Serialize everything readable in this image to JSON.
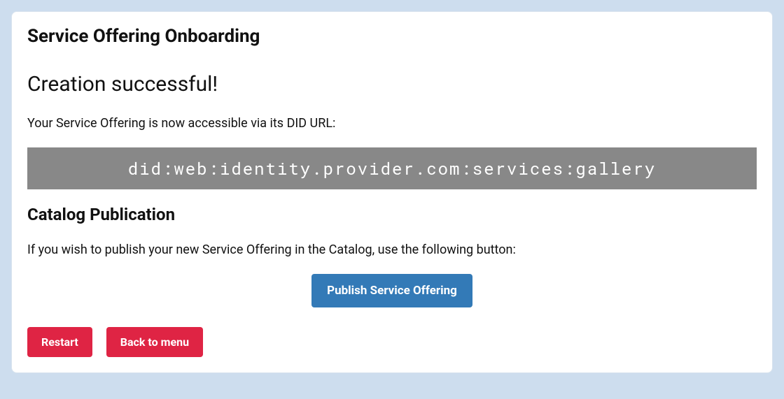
{
  "page": {
    "title": "Service Offering Onboarding",
    "success_heading": "Creation successful!",
    "did_intro": "Your Service Offering is now accessible via its DID URL:",
    "did_url": "did:web:identity.provider.com:services:gallery",
    "catalog_heading": "Catalog Publication",
    "catalog_text": "If you wish to publish your new Service Offering in the Catalog, use the following button:",
    "publish_label": "Publish Service Offering",
    "restart_label": "Restart",
    "back_label": "Back to menu"
  }
}
